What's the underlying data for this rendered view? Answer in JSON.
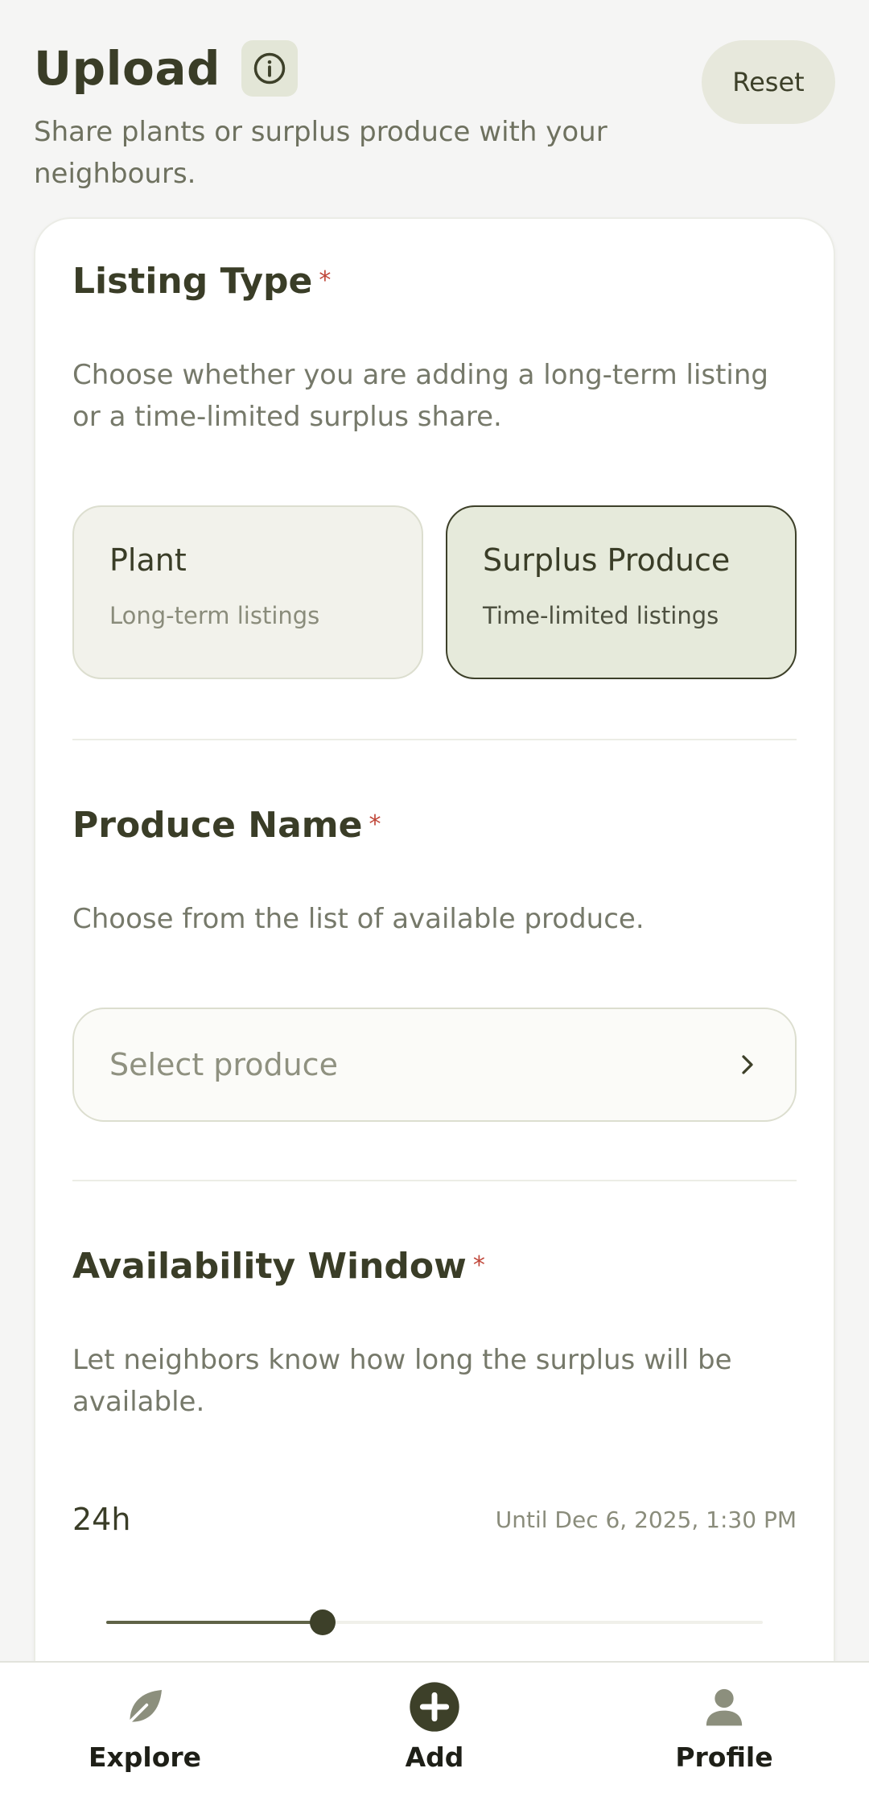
{
  "header": {
    "title": "Upload",
    "subtitle": "Share plants or surplus produce with your neighbours.",
    "reset_label": "Reset"
  },
  "listing_type": {
    "title": "Listing Type",
    "required_mark": "*",
    "description": "Choose whether you are adding a long-term listing or a time-limited surplus share.",
    "options": [
      {
        "title": "Plant",
        "subtitle": "Long-term listings",
        "selected": false
      },
      {
        "title": "Surplus Produce",
        "subtitle": "Time-limited listings",
        "selected": true
      }
    ]
  },
  "produce_name": {
    "title": "Produce Name",
    "required_mark": "*",
    "description": "Choose from the list of available produce.",
    "placeholder": "Select produce"
  },
  "availability": {
    "title": "Availability Window",
    "required_mark": "*",
    "description": "Let neighbors know how long the surplus will be available.",
    "value": "24h",
    "until": "Until Dec 6, 2025, 1:30 PM",
    "slider_fraction": 0.33
  },
  "nav": {
    "items": [
      {
        "label": "Explore",
        "icon": "leaf-icon"
      },
      {
        "label": "Add",
        "icon": "plus-circle-icon"
      },
      {
        "label": "Profile",
        "icon": "person-icon"
      }
    ]
  },
  "colors": {
    "accent": "#3d4029",
    "required": "#c0473a",
    "selected_bg": "#e6eadb"
  }
}
